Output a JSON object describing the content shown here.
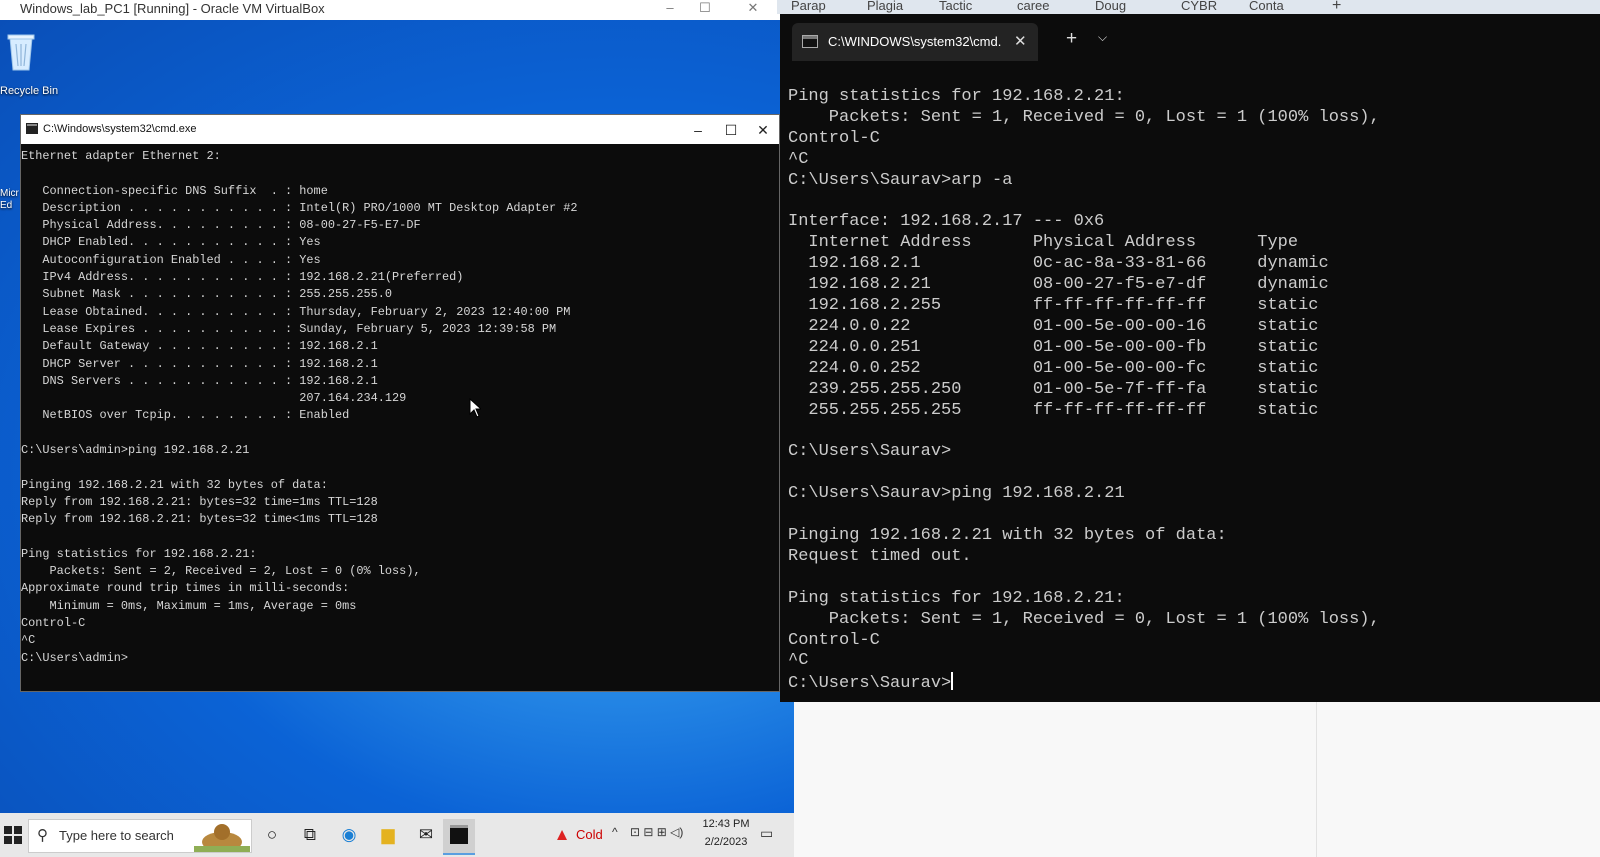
{
  "vbox": {
    "title": "Windows_lab_PC1 [Running] - Oracle VM VirtualBox"
  },
  "desktop": {
    "recycle_bin_label": "Recycle Bin",
    "edge_label": "Micr\nEd"
  },
  "guest_cmd": {
    "title": "C:\\Windows\\system32\\cmd.exe",
    "lines": [
      "Ethernet adapter Ethernet 2:",
      "",
      "   Connection-specific DNS Suffix  . : home",
      "   Description . . . . . . . . . . . : Intel(R) PRO/1000 MT Desktop Adapter #2",
      "   Physical Address. . . . . . . . . : 08-00-27-F5-E7-DF",
      "   DHCP Enabled. . . . . . . . . . . : Yes",
      "   Autoconfiguration Enabled . . . . : Yes",
      "   IPv4 Address. . . . . . . . . . . : 192.168.2.21(Preferred)",
      "   Subnet Mask . . . . . . . . . . . : 255.255.255.0",
      "   Lease Obtained. . . . . . . . . . : Thursday, February 2, 2023 12:40:00 PM",
      "   Lease Expires . . . . . . . . . . : Sunday, February 5, 2023 12:39:58 PM",
      "   Default Gateway . . . . . . . . . : 192.168.2.1",
      "   DHCP Server . . . . . . . . . . . : 192.168.2.1",
      "   DNS Servers . . . . . . . . . . . : 192.168.2.1",
      "                                       207.164.234.129",
      "   NetBIOS over Tcpip. . . . . . . . : Enabled",
      "",
      "C:\\Users\\admin>ping 192.168.2.21",
      "",
      "Pinging 192.168.2.21 with 32 bytes of data:",
      "Reply from 192.168.2.21: bytes=32 time=1ms TTL=128",
      "Reply from 192.168.2.21: bytes=32 time<1ms TTL=128",
      "",
      "Ping statistics for 192.168.2.21:",
      "    Packets: Sent = 2, Received = 2, Lost = 0 (0% loss),",
      "Approximate round trip times in milli-seconds:",
      "    Minimum = 0ms, Maximum = 1ms, Average = 0ms",
      "Control-C",
      "^C",
      "C:\\Users\\admin>"
    ]
  },
  "guest_taskbar": {
    "search_placeholder": "Type here to search",
    "weather": "Cold",
    "time": "12:43 PM",
    "date": "2/2/2023"
  },
  "host_tabs": [
    "Parap",
    "Plagia",
    "Tactic",
    "caree",
    "Doug",
    "CYBR",
    "Conta"
  ],
  "host_term": {
    "tab_title": "C:\\WINDOWS\\system32\\cmd.",
    "lines": [
      "Ping statistics for 192.168.2.21:",
      "    Packets: Sent = 1, Received = 0, Lost = 1 (100% loss),",
      "Control-C",
      "^C",
      "C:\\Users\\Saurav>arp -a",
      "",
      "Interface: 192.168.2.17 --- 0x6",
      "  Internet Address      Physical Address      Type",
      "  192.168.2.1           0c-ac-8a-33-81-66     dynamic",
      "  192.168.2.21          08-00-27-f5-e7-df     dynamic",
      "  192.168.2.255         ff-ff-ff-ff-ff-ff     static",
      "  224.0.0.22            01-00-5e-00-00-16     static",
      "  224.0.0.251           01-00-5e-00-00-fb     static",
      "  224.0.0.252           01-00-5e-00-00-fc     static",
      "  239.255.255.250       01-00-5e-7f-ff-fa     static",
      "  255.255.255.255       ff-ff-ff-ff-ff-ff     static",
      "",
      "C:\\Users\\Saurav>",
      "",
      "C:\\Users\\Saurav>ping 192.168.2.21",
      "",
      "Pinging 192.168.2.21 with 32 bytes of data:",
      "Request timed out.",
      "",
      "Ping statistics for 192.168.2.21:",
      "    Packets: Sent = 1, Received = 0, Lost = 1 (100% loss),",
      "Control-C",
      "^C"
    ],
    "prompt": "C:\\Users\\Saurav>"
  },
  "icons": {
    "vbox_minimize": "minimize-icon",
    "vbox_maximize": "maximize-icon",
    "vbox_close": "close-icon",
    "new_tab": "plus-icon",
    "dropdown": "chevron-down-icon"
  }
}
